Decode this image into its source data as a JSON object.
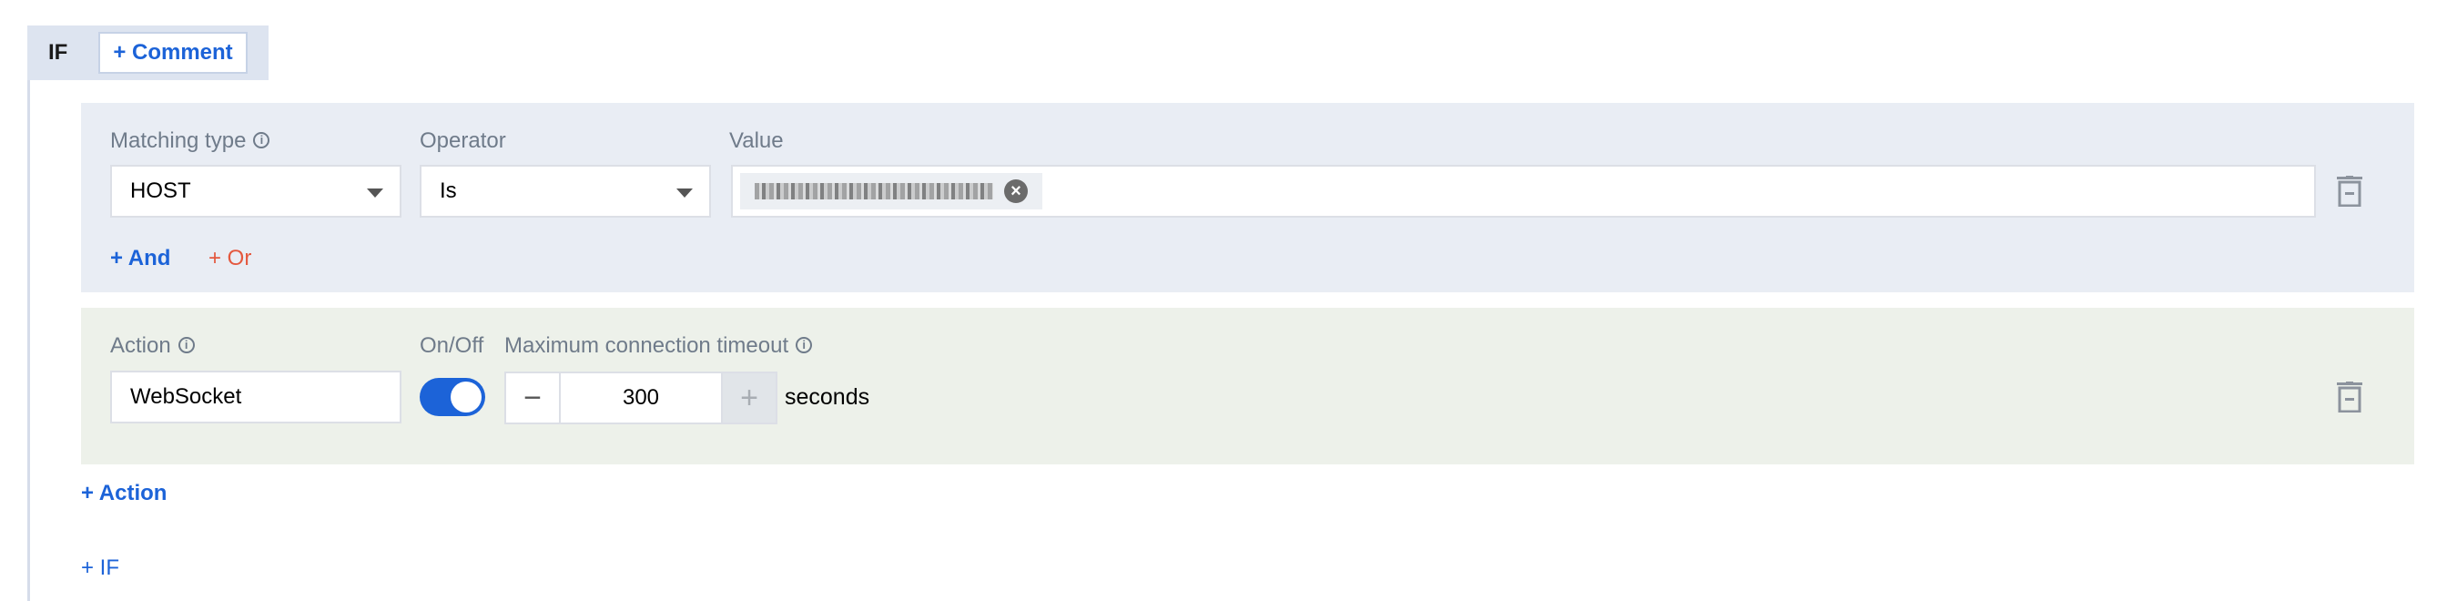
{
  "if_block": {
    "label": "IF",
    "comment_button": "+ Comment"
  },
  "condition": {
    "matching_type": {
      "label": "Matching type",
      "value": "HOST"
    },
    "operator": {
      "label": "Operator",
      "value": "Is"
    },
    "value": {
      "label": "Value",
      "tag_redacted": true
    },
    "and_link": "+ And",
    "or_link": "+ Or"
  },
  "action": {
    "label": "Action",
    "value": "WebSocket",
    "onoff_label": "On/Off",
    "toggle_on": true,
    "timeout_label": "Maximum connection timeout",
    "timeout_value": "300",
    "unit": "seconds",
    "minus": "−",
    "plus": "+"
  },
  "add_action_link": "+ Action",
  "add_if_link": "+ IF",
  "icons": [
    "info-icon",
    "chevron-down-icon",
    "close-icon",
    "trash-icon"
  ],
  "colors": {
    "accent": "#1c63d8",
    "or_link": "#e4583e",
    "condition_bg": "#e9edf4",
    "action_bg": "#edf1ea"
  }
}
